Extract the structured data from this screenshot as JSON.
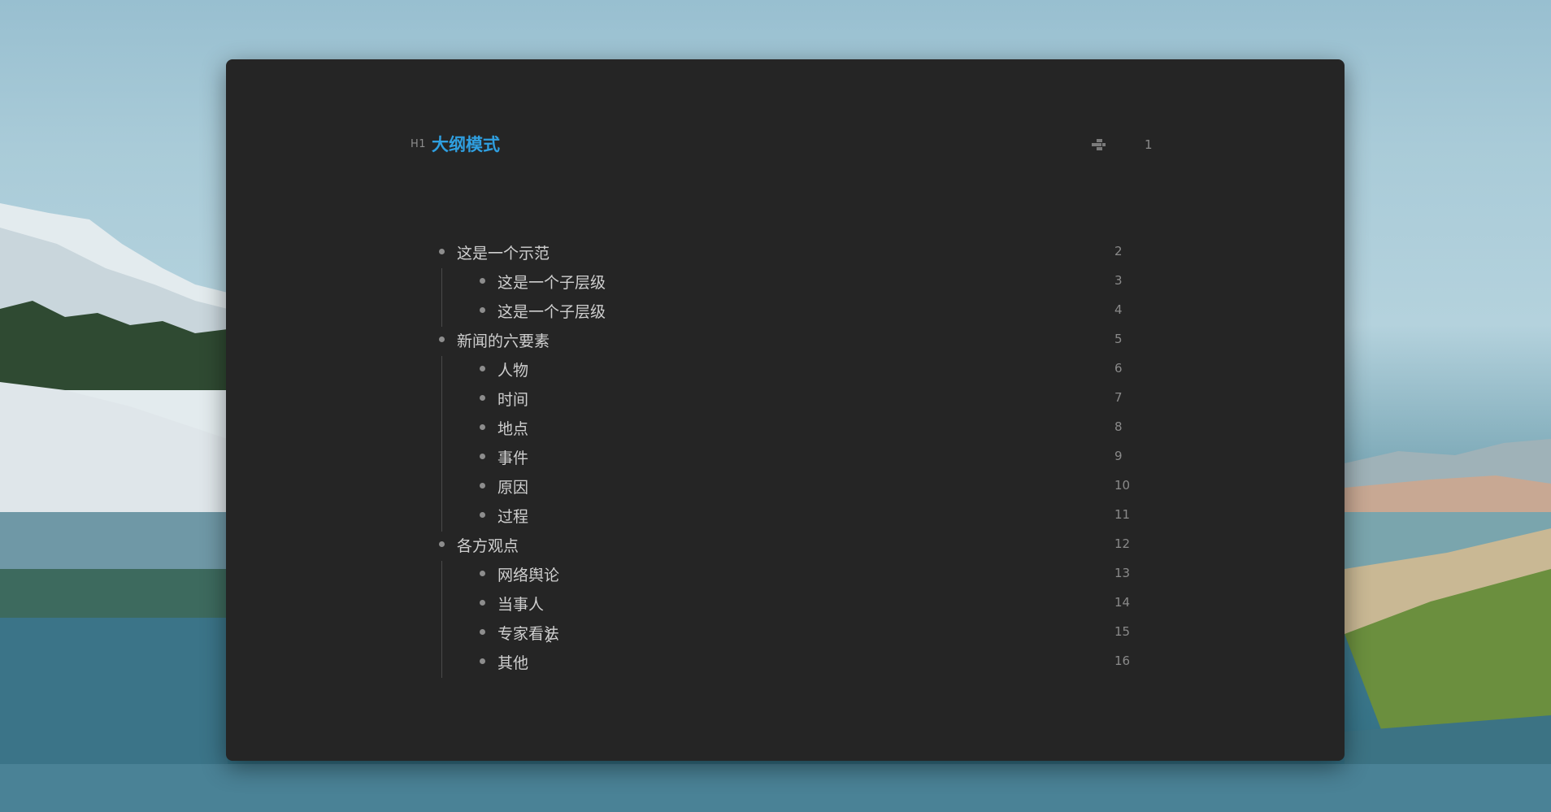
{
  "document": {
    "heading_level": "H1",
    "heading": "大纲模式",
    "heading_line_number": "1",
    "heading_color": "#2f9fe0"
  },
  "outline": [
    {
      "text": "这是一个示范",
      "level": 1,
      "line": "2"
    },
    {
      "text": "这是一个子层级",
      "level": 2,
      "line": "3"
    },
    {
      "text": "这是一个子层级",
      "level": 2,
      "line": "4"
    },
    {
      "text": "新闻的六要素",
      "level": 1,
      "line": "5"
    },
    {
      "text": "人物",
      "level": 2,
      "line": "6"
    },
    {
      "text": "时间",
      "level": 2,
      "line": "7"
    },
    {
      "text": "地点",
      "level": 2,
      "line": "8"
    },
    {
      "text": "事件",
      "level": 2,
      "line": "9"
    },
    {
      "text": "原因",
      "level": 2,
      "line": "10"
    },
    {
      "text": "过程",
      "level": 2,
      "line": "11"
    },
    {
      "text": "各方观点",
      "level": 1,
      "line": "12"
    },
    {
      "text": "网络舆论",
      "level": 2,
      "line": "13"
    },
    {
      "text": "当事人",
      "level": 2,
      "line": "14"
    },
    {
      "text": "专家看法",
      "level": 2,
      "line": "15"
    },
    {
      "text": "其他",
      "level": 2,
      "line": "16"
    }
  ],
  "icons": {
    "fold": "outline-fold-icon",
    "cursor": "text-cursor-icon"
  },
  "theme": {
    "editor_background": "#252525",
    "text_color": "#cfcfcf",
    "muted_color": "#8a8a8a"
  }
}
